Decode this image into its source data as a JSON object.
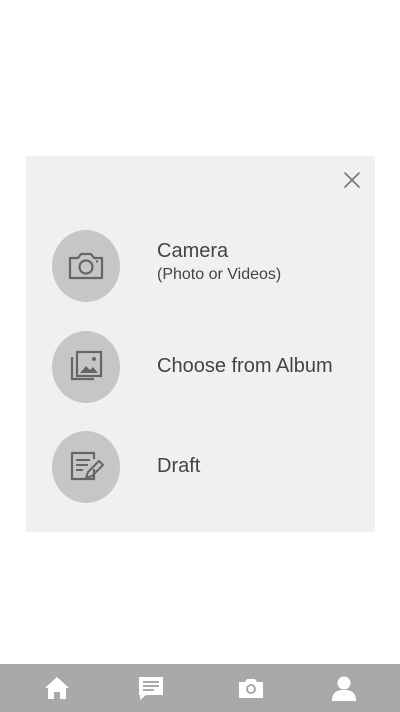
{
  "sheet": {
    "close_icon": "close-icon",
    "options": [
      {
        "label": "Camera",
        "sublabel": "(Photo or Videos)",
        "icon": "camera-icon"
      },
      {
        "label": "Choose from Album",
        "icon": "album-icon"
      },
      {
        "label": "Draft",
        "icon": "draft-icon"
      }
    ]
  },
  "bottom_nav": {
    "items": [
      {
        "icon": "home-icon"
      },
      {
        "icon": "chat-icon"
      },
      {
        "icon": "camera-icon"
      },
      {
        "icon": "profile-icon"
      }
    ]
  },
  "colors": {
    "sheet_bg": "#f0f0f0",
    "circle_bg": "#c6c6c6",
    "nav_bg": "#a9a9a9",
    "text": "#444444"
  }
}
